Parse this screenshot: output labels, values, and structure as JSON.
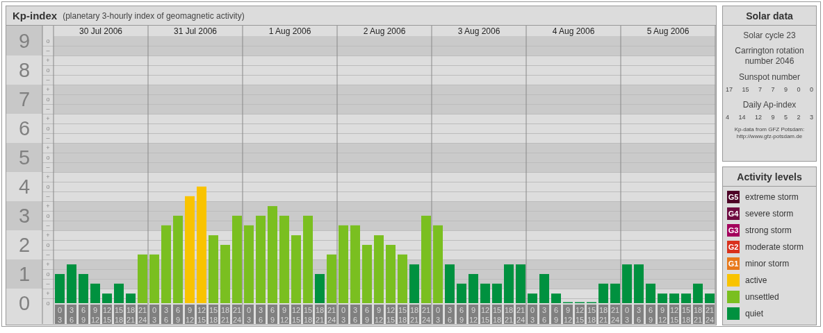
{
  "title": {
    "name": "Kp-index",
    "subtitle": "(planetary 3-hourly index of geomagnetic activity)"
  },
  "chart": {
    "dates": [
      "30 Jul 2006",
      "31 Jul 2006",
      "1 Aug 2006",
      "2 Aug 2006",
      "3 Aug 2006",
      "4 Aug 2006",
      "5 Aug 2006"
    ],
    "scale_marks": [
      "o",
      "–",
      "+",
      "o",
      "–",
      "+",
      "o",
      "–",
      "+",
      "o",
      "–",
      "+",
      "o",
      "–",
      "+",
      "o",
      "–",
      "+",
      "o",
      "–",
      "+",
      "o",
      "–",
      "+",
      "o",
      "–",
      "+",
      "o"
    ],
    "chart_data": {
      "type": "bar",
      "grid": true,
      "ylim": [
        0,
        9.52
      ],
      "yticks": [
        {
          "value": 0,
          "label": "0"
        },
        {
          "value": 1,
          "label": "1"
        },
        {
          "value": 2,
          "label": "2"
        },
        {
          "value": 3,
          "label": "3"
        },
        {
          "value": 4,
          "label": "4"
        },
        {
          "value": 5,
          "label": "5"
        },
        {
          "value": 6,
          "label": "6"
        },
        {
          "value": 7,
          "label": "7"
        },
        {
          "value": 8,
          "label": "8"
        },
        {
          "value": 9,
          "label": "9"
        }
      ],
      "categories": [
        "0 3",
        "3 6",
        "6 9",
        "9 12",
        "12 15",
        "15 18",
        "18 21",
        "21 24",
        "0 3",
        "3 6",
        "6 9",
        "9 12",
        "12 15",
        "15 18",
        "18 21",
        "21 24",
        "0 3",
        "3 6",
        "6 9",
        "9 12",
        "12 15",
        "15 18",
        "18 21",
        "21 24",
        "0 3",
        "3 6",
        "6 9",
        "9 12",
        "12 15",
        "15 18",
        "18 21",
        "21 24",
        "0 3",
        "3 6",
        "6 9",
        "9 12",
        "12 15",
        "15 18",
        "18 21",
        "21 24",
        "0 3",
        "3 6",
        "6 9",
        "9 12",
        "12 15",
        "15 18",
        "18 21",
        "21 24",
        "0 3",
        "3 6",
        "6 9",
        "9 12",
        "12 15",
        "15 18",
        "18 21",
        "21 24"
      ],
      "series": [
        {
          "color": "#00913f",
          "values": [
            1,
            1.33,
            1,
            0.67,
            0.33,
            0.67,
            0.33,
            null,
            null,
            null,
            null,
            null,
            null,
            null,
            null,
            null,
            null,
            null,
            null,
            null,
            null,
            null,
            1,
            null,
            null,
            null,
            null,
            null,
            null,
            null,
            1.33,
            null,
            null,
            1.33,
            0.67,
            1,
            0.67,
            0.67,
            1.33,
            1.33,
            0.33,
            1,
            0.33,
            0,
            0,
            0,
            0.67,
            0.67,
            1.33,
            1.33,
            0.67,
            0.33,
            0.33,
            0.33,
            0.67,
            0.33
          ]
        },
        {
          "color": "#7abf20",
          "values": [
            null,
            null,
            null,
            null,
            null,
            null,
            null,
            1.67,
            1.67,
            2.67,
            3,
            null,
            null,
            2.33,
            2,
            3,
            2.67,
            3,
            3.33,
            3,
            2.33,
            3,
            null,
            1.67,
            2.67,
            2.67,
            2,
            2.33,
            2,
            1.67,
            null,
            3,
            2.67,
            null,
            null,
            null,
            null,
            null,
            null,
            null,
            null,
            null,
            null,
            null,
            null,
            null,
            null,
            null,
            null,
            null,
            null,
            null,
            null,
            null,
            null,
            null
          ]
        },
        {
          "color": "#f9c300",
          "values": [
            null,
            null,
            null,
            null,
            null,
            null,
            null,
            null,
            null,
            null,
            null,
            3.67,
            4,
            null,
            null,
            null,
            null,
            null,
            null,
            null,
            null,
            null,
            null,
            null,
            null,
            null,
            null,
            null,
            null,
            null,
            null,
            null,
            null,
            null,
            null,
            null,
            null,
            null,
            null,
            null,
            null,
            null,
            null,
            null,
            null,
            null,
            null,
            null,
            null,
            null,
            null,
            null,
            null,
            null,
            null,
            null
          ]
        }
      ]
    }
  },
  "solar_data": {
    "title": "Solar data",
    "cycle": "Solar cycle 23",
    "rotation": "Carrington rotation number 2046",
    "sunspot_label": "Sunspot number",
    "sunspot_numbers": [
      "17",
      "15",
      "7",
      "7",
      "9",
      "0",
      "0"
    ],
    "ap_label": "Daily Ap-index",
    "ap_values": [
      "4",
      "14",
      "12",
      "9",
      "5",
      "2",
      "3"
    ],
    "source": "Kp-data from GFZ Potsdam:",
    "source_url": "http://www.gfz-potsdam.de"
  },
  "activity_levels": {
    "title": "Activity levels",
    "items": [
      {
        "badge": "G5",
        "label": "extreme storm",
        "color": "#4d0026"
      },
      {
        "badge": "G4",
        "label": "severe storm",
        "color": "#6e0a40"
      },
      {
        "badge": "G3",
        "label": "strong storm",
        "color": "#a3005c"
      },
      {
        "badge": "G2",
        "label": "moderate storm",
        "color": "#d9301c"
      },
      {
        "badge": "G1",
        "label": "minor storm",
        "color": "#e8781a"
      },
      {
        "label": "active",
        "color": "#f9c300"
      },
      {
        "label": "unsettled",
        "color": "#7abf20"
      },
      {
        "label": "quiet",
        "color": "#00913f"
      }
    ]
  }
}
